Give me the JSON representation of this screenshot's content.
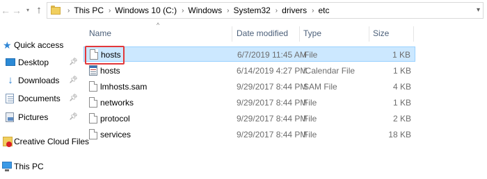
{
  "address_bar": {
    "crumbs": [
      "This PC",
      "Windows 10 (C:)",
      "Windows",
      "System32",
      "drivers",
      "etc"
    ]
  },
  "nav_pane": {
    "items": [
      {
        "label": "Quick access",
        "icon": "star-icon"
      },
      {
        "label": "Desktop",
        "icon": "desktop-icon",
        "pinned": true
      },
      {
        "label": "Downloads",
        "icon": "download-icon",
        "pinned": true
      },
      {
        "label": "Documents",
        "icon": "documents-icon",
        "pinned": true
      },
      {
        "label": "Pictures",
        "icon": "pictures-icon",
        "pinned": true
      },
      {
        "label": "Creative Cloud Files",
        "icon": "creative-cloud-icon"
      },
      {
        "label": "This PC",
        "icon": "computer-icon"
      }
    ]
  },
  "file_list": {
    "columns": {
      "name": "Name",
      "date": "Date modified",
      "type": "Type",
      "size": "Size"
    },
    "rows": [
      {
        "name": "hosts",
        "date": "6/7/2019 11:45 AM",
        "type": "File",
        "size": "1 KB",
        "icon": "file-icon",
        "selected": true
      },
      {
        "name": "hosts",
        "date": "6/14/2019 4:27 PM",
        "type": "iCalendar File",
        "size": "1 KB",
        "icon": "calendar-file-icon"
      },
      {
        "name": "lmhosts.sam",
        "date": "9/29/2017 8:44 PM",
        "type": "SAM File",
        "size": "4 KB",
        "icon": "file-icon"
      },
      {
        "name": "networks",
        "date": "9/29/2017 8:44 PM",
        "type": "File",
        "size": "1 KB",
        "icon": "file-icon"
      },
      {
        "name": "protocol",
        "date": "9/29/2017 8:44 PM",
        "type": "File",
        "size": "2 KB",
        "icon": "file-icon"
      },
      {
        "name": "services",
        "date": "9/29/2017 8:44 PM",
        "type": "File",
        "size": "18 KB",
        "icon": "file-icon"
      }
    ]
  },
  "colors": {
    "selection_bg": "#cce8ff",
    "selection_border": "#99d1ff",
    "highlight_box": "#e2373a",
    "header_text": "#4c607a",
    "accent": "#2f86d6"
  }
}
